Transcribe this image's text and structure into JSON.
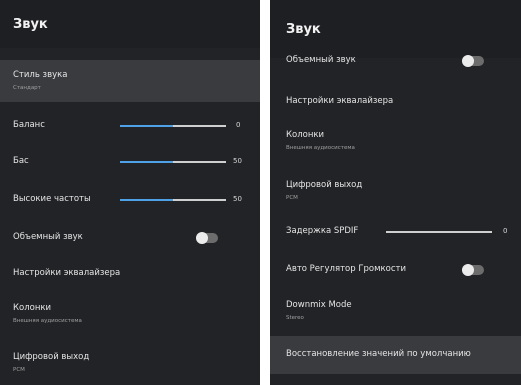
{
  "left": {
    "title": "Звук",
    "sound_style": {
      "label": "Стиль звука",
      "value": "Стандарт"
    },
    "balance": {
      "label": "Баланс",
      "value": "0",
      "level": 0.5
    },
    "bass": {
      "label": "Бас",
      "value": "50",
      "level": 0.5
    },
    "treble": {
      "label": "Высокие частоты",
      "value": "50",
      "level": 0.5
    },
    "surround": {
      "label": "Объемный звук"
    },
    "equalizer": {
      "label": "Настройки эквалайзера"
    },
    "speakers": {
      "label": "Колонки",
      "value": "Внешняя аудиосистема"
    },
    "digital_out": {
      "label": "Цифровой выход",
      "value": "PCM"
    }
  },
  "right": {
    "title": "Звук",
    "surround": {
      "label": "Объемный звук"
    },
    "equalizer": {
      "label": "Настройки эквалайзера"
    },
    "speakers": {
      "label": "Колонки",
      "value": "Внешняя аудиосистема"
    },
    "digital_out": {
      "label": "Цифровой выход",
      "value": "PCM"
    },
    "spdif_delay": {
      "label": "Задержка SPDIF",
      "value": "0",
      "level": 0
    },
    "auto_volume": {
      "label": "Авто Регулятор Громкости"
    },
    "downmix": {
      "label": "Downmix Mode",
      "value": "Stereo"
    },
    "reset": {
      "label": "Восстановление значений по умолчанию"
    }
  }
}
